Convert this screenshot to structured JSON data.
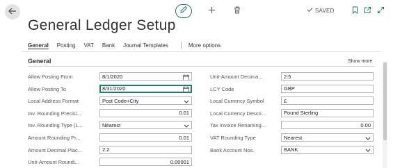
{
  "window": {
    "saved_label": "SAVED"
  },
  "page": {
    "title": "General Ledger Setup"
  },
  "tabs": [
    {
      "label": "General",
      "active": true
    },
    {
      "label": "Posting",
      "active": false
    },
    {
      "label": "VAT",
      "active": false
    },
    {
      "label": "Bank",
      "active": false
    },
    {
      "label": "Journal Templates",
      "active": false
    }
  ],
  "more_options": "More options",
  "section": {
    "title": "General",
    "show_more": "Show more"
  },
  "left_fields": [
    {
      "label": "Allow Posting From",
      "value": "8/1/2020",
      "kind": "date"
    },
    {
      "label": "Allow Posting To",
      "value": "8/31/2020",
      "kind": "date"
    },
    {
      "label": "Local Address Format",
      "value": "Post Code+City",
      "kind": "select"
    },
    {
      "label": "Inv. Rounding Precisi...",
      "value": "0.01",
      "kind": "number"
    },
    {
      "label": "Inv. Rounding Type (L...",
      "value": "Nearest",
      "kind": "select"
    },
    {
      "label": "Amount Rounding Pr...",
      "value": "0.01",
      "kind": "number"
    },
    {
      "label": "Amount Decimal Plac...",
      "value": "2:2",
      "kind": "text"
    },
    {
      "label": "Unit-Amount Roundi...",
      "value": "0.00001",
      "kind": "number"
    }
  ],
  "right_fields": [
    {
      "label": "Unit-Amount Decima...",
      "value": "2:5",
      "kind": "text"
    },
    {
      "label": "LCY Code",
      "value": "GBP",
      "kind": "text"
    },
    {
      "label": "Local Currency Symbol",
      "value": "£",
      "kind": "text"
    },
    {
      "label": "Local Currency Descri...",
      "value": "Pound Sterling",
      "kind": "text"
    },
    {
      "label": "Tax Invoice Renaming...",
      "value": "0.00",
      "kind": "number"
    },
    {
      "label": "VAT Rounding Type",
      "value": "Nearest",
      "kind": "select"
    },
    {
      "label": "Bank Account Nos.",
      "value": "BANK",
      "kind": "select"
    }
  ],
  "icons": {
    "back": "arrow-left-icon",
    "edit": "pencil-icon",
    "new": "plus-icon",
    "delete": "trash-icon",
    "saved": "check-icon",
    "bookmark": "bookmark-icon",
    "open_new_window": "open-new-window-icon",
    "expand": "expand-icon",
    "calendar": "calendar-icon",
    "dropdown": "chevron-down-icon"
  },
  "colors": {
    "accent": "#1c7f6a",
    "text": "#212121",
    "label": "#555555"
  }
}
